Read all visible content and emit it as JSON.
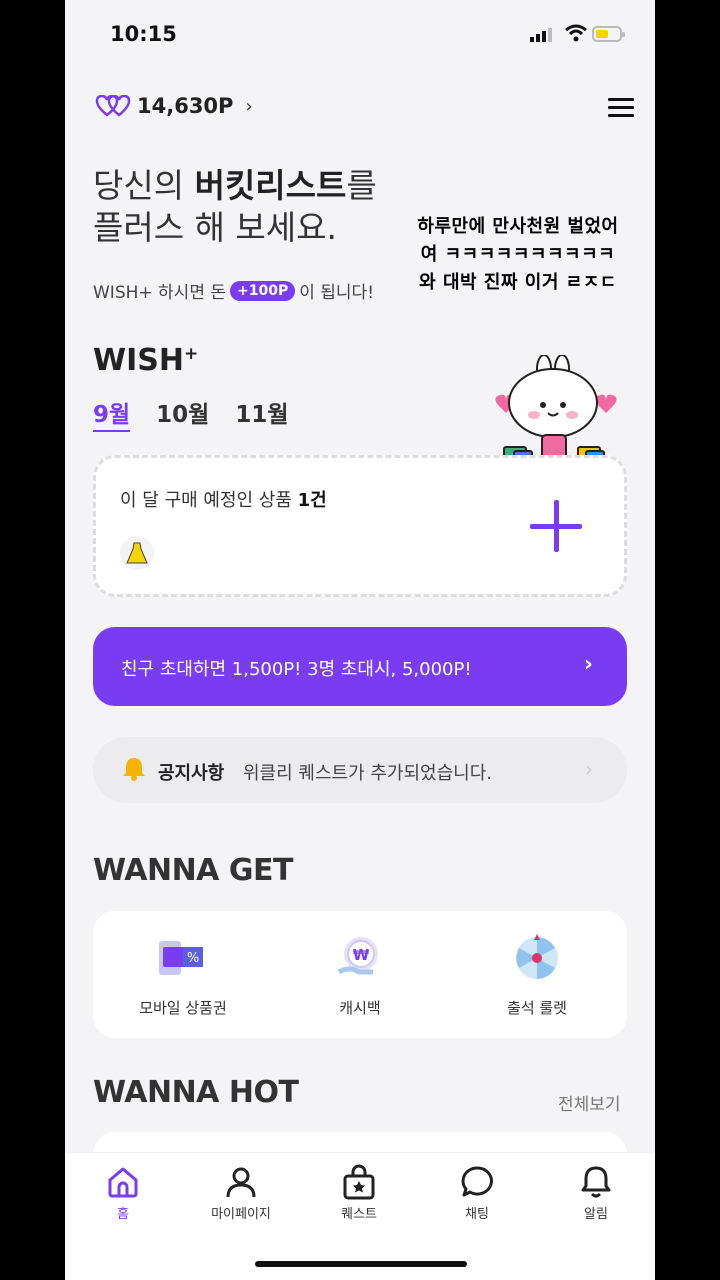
{
  "status_bar": {
    "time": "10:15"
  },
  "header": {
    "points": "14,630P",
    "points_arrow": "›",
    "logo_icon": "heart-w-logo-icon",
    "menu_icon": "hamburger-icon"
  },
  "hero": {
    "line1_prefix": "당신의 ",
    "line1_bold": "버킷리스트",
    "line1_suffix": "를",
    "line2": "플러스 해 보세요.",
    "sub_prefix": "WISH+ 하시면 돈",
    "sub_pill": "+100P",
    "sub_suffix": "이 됩니다!"
  },
  "overlay_text": [
    "하루만에 만사천원 벌었어",
    "여 ㅋㅋㅋㅋㅋㅋㅋㅋㅋㅋ",
    "와 대박  진짜 이거 ㄹㅈㄷ"
  ],
  "wish": {
    "title": "WISH",
    "title_sup": "+",
    "months": [
      "9월",
      "10월",
      "11월"
    ],
    "active_month": "9월",
    "card_text": "이 달 구매 예정인 상품 ",
    "card_count": "1건"
  },
  "invite": {
    "label": "친구 초대하면 1,500P! 3명 초대시, 5,000P!",
    "chevron": "›"
  },
  "notice": {
    "tag": "공지사항",
    "message": "위클리 퀘스트가 추가되었습니다.",
    "chevron": "›"
  },
  "wanna_get": {
    "title": "WANNA GET",
    "items": [
      {
        "label": "모바일 상품권",
        "icon": "gift-card-icon"
      },
      {
        "label": "캐시백",
        "icon": "cashback-icon"
      },
      {
        "label": "출석 룰렛",
        "icon": "roulette-icon"
      }
    ]
  },
  "wanna_hot": {
    "title": "WANNA HOT",
    "see_all": "전체보기"
  },
  "tabs": [
    {
      "label": "홈",
      "icon": "home-icon",
      "active": true
    },
    {
      "label": "마이페이지",
      "icon": "person-icon",
      "active": false
    },
    {
      "label": "퀘스트",
      "icon": "quest-bag-icon",
      "active": false
    },
    {
      "label": "채팅",
      "icon": "chat-icon",
      "active": false
    },
    {
      "label": "알림",
      "icon": "bell-icon",
      "active": false
    }
  ],
  "colors": {
    "accent": "#7a3cf0",
    "background": "#f4f4f6"
  }
}
